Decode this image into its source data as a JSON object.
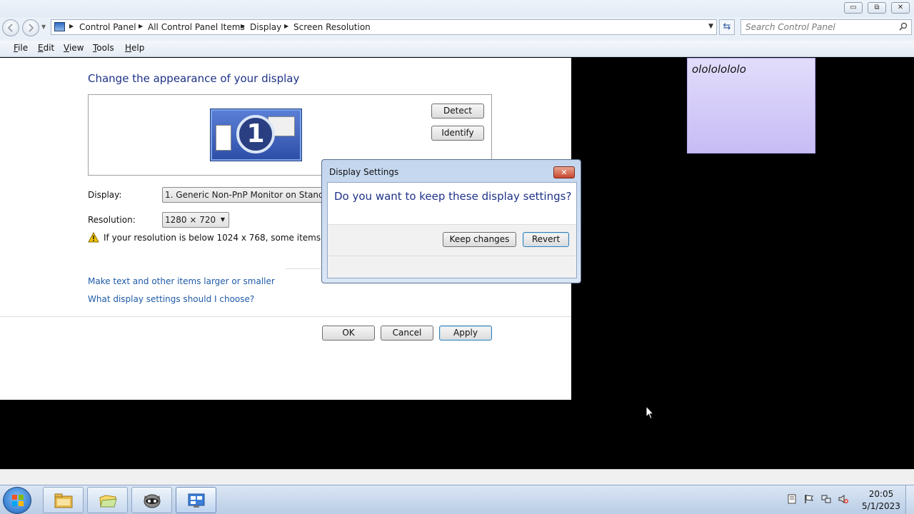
{
  "window": {
    "caption_buttons": {
      "minimize": "▭",
      "maximize": "⧉",
      "close": "✕"
    },
    "breadcrumb": [
      "Control Panel",
      "All Control Panel Items",
      "Display",
      "Screen Resolution"
    ],
    "search_placeholder": "Search Control Panel",
    "menu": [
      "File",
      "Edit",
      "View",
      "Tools",
      "Help"
    ]
  },
  "content": {
    "heading": "Change the appearance of your display",
    "monitor_number": "1",
    "detect_label": "Detect",
    "identify_label": "Identify",
    "display_label": "Display:",
    "display_value": "1. Generic Non-PnP Monitor on Standard",
    "resolution_label": "Resolution:",
    "resolution_value": "1280 × 720",
    "warning_text": "If your resolution is below 1024 x 768, some items may not",
    "links": [
      "Make text and other items larger or smaller",
      "What display settings should I choose?"
    ],
    "ok_label": "OK",
    "cancel_label": "Cancel",
    "apply_label": "Apply"
  },
  "dialog": {
    "title": "Display Settings",
    "close_glyph": "✕",
    "question": "Do you want to keep these display settings?",
    "keep_label": "Keep changes",
    "revert_label": "Revert"
  },
  "sticky_note": {
    "text": "olololololo"
  },
  "taskbar": {
    "items": [
      "windows-explorer",
      "folder",
      "raccoon-app",
      "control-panel"
    ],
    "tray_icons": [
      "notes-icon",
      "action-center-flag-icon",
      "network-icon",
      "volume-muted-icon"
    ],
    "clock_time": "20:05",
    "clock_date": "5/1/2023"
  },
  "colors": {
    "heading_blue": "#1e3287",
    "link_blue": "#1e5aa8",
    "sticky_purple": "#d4cdf8",
    "desktop_black": "#000000"
  }
}
